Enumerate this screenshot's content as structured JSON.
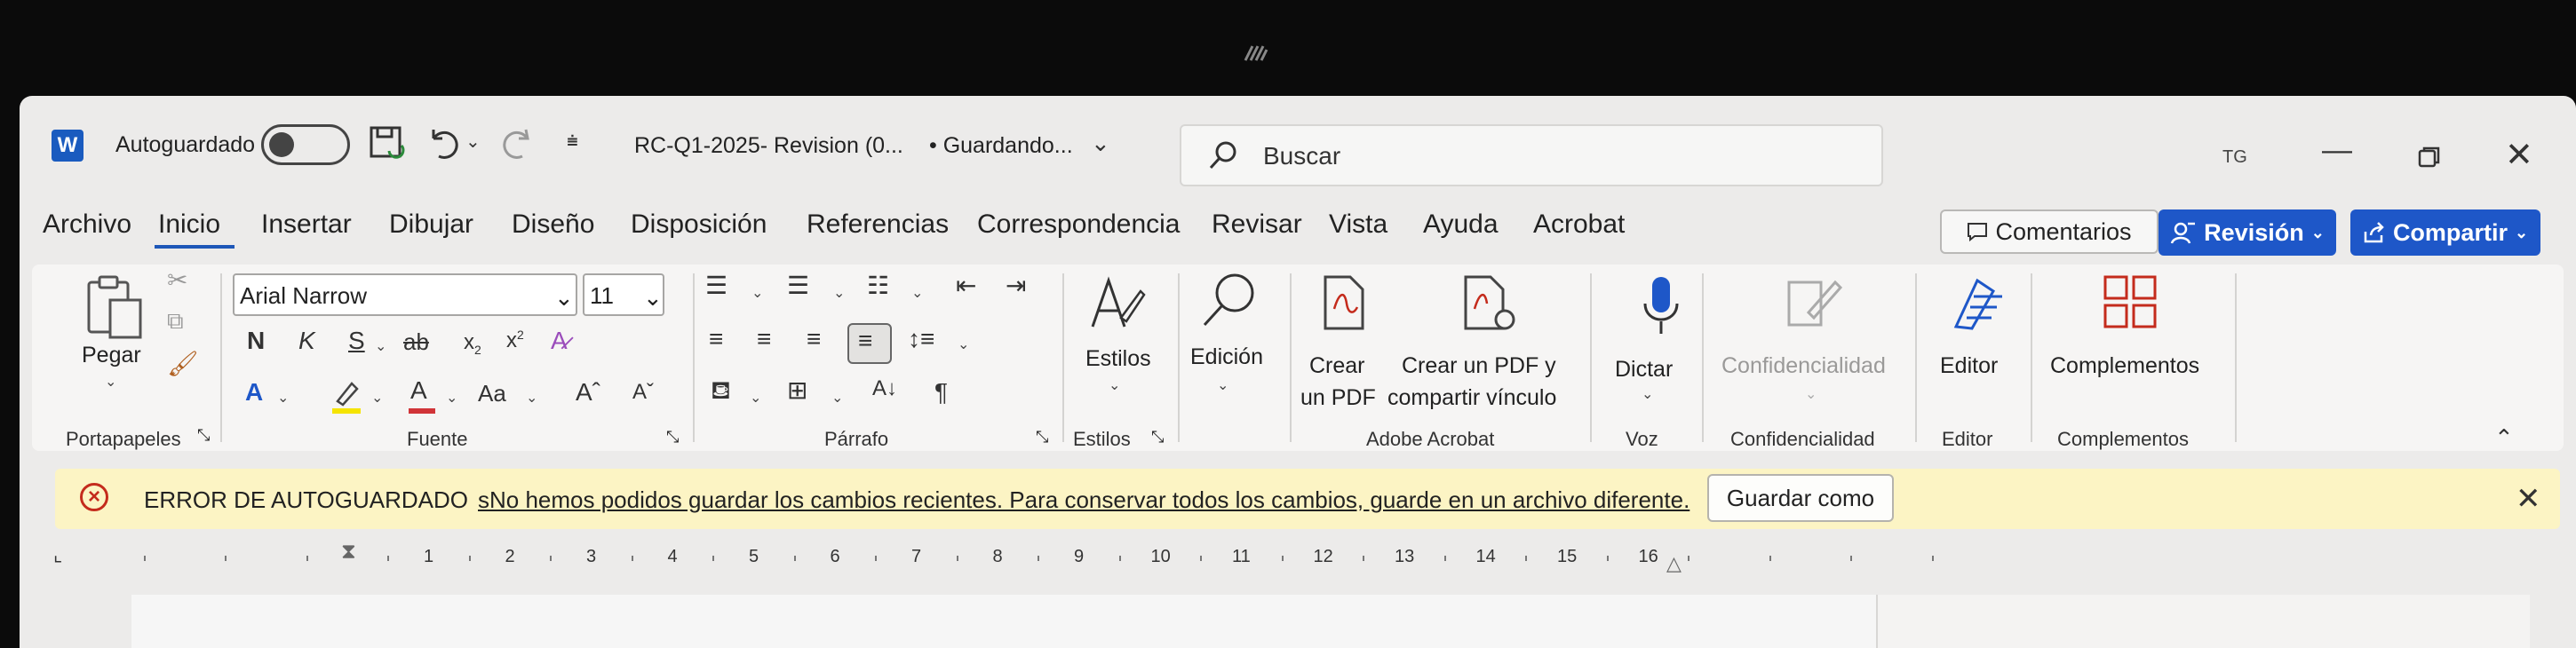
{
  "titlebar": {
    "autosave_label": "Autoguardado",
    "document_title": "RC-Q1-2025- Revision (0...",
    "status": "• Guardando...",
    "search_placeholder": "Buscar",
    "user_initials": "TG"
  },
  "tabs": [
    {
      "label": "Archivo"
    },
    {
      "label": "Inicio"
    },
    {
      "label": "Insertar"
    },
    {
      "label": "Dibujar"
    },
    {
      "label": "Diseño"
    },
    {
      "label": "Disposición"
    },
    {
      "label": "Referencias"
    },
    {
      "label": "Correspondencia"
    },
    {
      "label": "Revisar"
    },
    {
      "label": "Vista"
    },
    {
      "label": "Ayuda"
    },
    {
      "label": "Acrobat"
    }
  ],
  "header_buttons": {
    "comments": "Comentarios",
    "review": "Revisión",
    "share": "Compartir"
  },
  "ribbon": {
    "paste_label": "Pegar",
    "font_name": "Arial Narrow",
    "font_size": "11",
    "bold": "N",
    "italic": "K",
    "underline": "S",
    "strike": "ab",
    "change_case": "Aa",
    "styles": "Estilos",
    "editing": "Edición",
    "create_pdf_line1": "Crear",
    "create_pdf_line2": "un PDF",
    "create_share_line1": "Crear un PDF y",
    "create_share_line2": "compartir vínculo",
    "dictate": "Dictar",
    "sensitivity": "Confidencialidad",
    "editor": "Editor",
    "addins": "Complementos"
  },
  "groups": {
    "clipboard": "Portapapeles",
    "font": "Fuente",
    "paragraph": "Párrafo",
    "styles": "Estilos",
    "acrobat": "Adobe Acrobat",
    "voice": "Voz",
    "sensitivity": "Confidencialidad",
    "editor": "Editor",
    "addins": "Complementos"
  },
  "notification": {
    "title": "ERROR DE AUTOGUARDADO",
    "message": "sNo hemos podidos guardar los cambios recientes. Para conservar todos los cambios, guarde en un archivo diferente.",
    "button": "Guardar como"
  },
  "ruler": {
    "numbers": [
      "1",
      "2",
      "3",
      "4",
      "5",
      "6",
      "7",
      "8",
      "9",
      "10",
      "11",
      "12",
      "13",
      "14",
      "15",
      "16"
    ]
  },
  "colors": {
    "accent": "#1e57c8",
    "error": "#c42b1c",
    "notification_bg": "#fcf4c4",
    "font_color_red": "#d13438",
    "highlight_yellow": "#f5e400"
  }
}
